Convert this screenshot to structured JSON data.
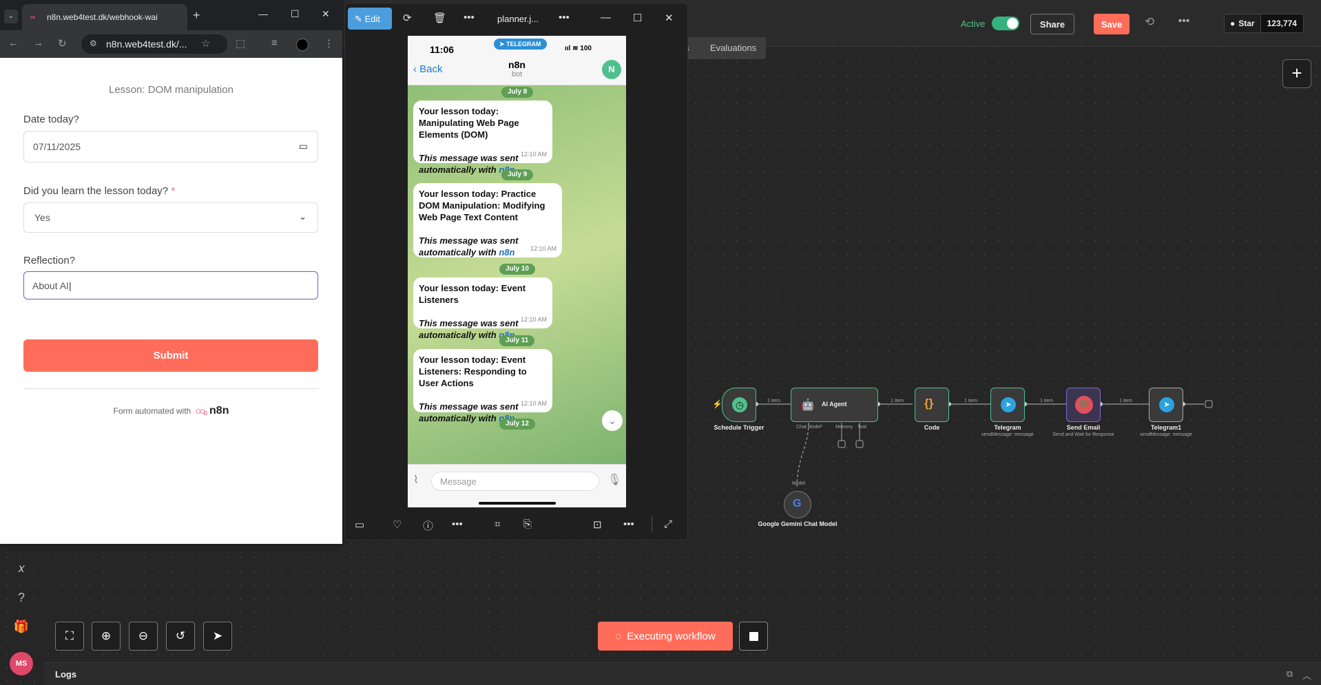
{
  "n8n": {
    "active_label": "Active",
    "share_label": "Share",
    "save_label": "Save",
    "star_label": "Star",
    "star_count": "123,774",
    "tab_partial": "s",
    "tab_evaluations": "Evaluations",
    "executing_label": "Executing workflow",
    "logs_label": "Logs",
    "avatar_initials": "MS",
    "accent_color": "#ff6d5a",
    "active_color": "#35b37e"
  },
  "workflow": {
    "nodes": [
      {
        "name": "Schedule Trigger",
        "icon": "clock-icon"
      },
      {
        "name": "AI Agent",
        "icon": "robot-icon",
        "ports": [
          "Chat Model*",
          "Memory",
          "Tool"
        ]
      },
      {
        "name": "Code",
        "icon": "braces-icon"
      },
      {
        "name": "Telegram",
        "sub": "sendMessage: message",
        "icon": "telegram-icon"
      },
      {
        "name": "Send Email",
        "sub": "Send and Wait for Response",
        "icon": "email-icon"
      },
      {
        "name": "Telegram1",
        "sub": "sendMessage: message",
        "icon": "telegram-icon"
      },
      {
        "name": "Google Gemini Chat Model",
        "icon": "google-icon",
        "port": "Model"
      }
    ],
    "connection_label": "1 item"
  },
  "browser": {
    "tab_title": "n8n.web4test.dk/webhook-wai",
    "url": "n8n.web4test.dk/..."
  },
  "form": {
    "lesson": "Lesson: DOM manipulation",
    "date_label": "Date today?",
    "date_value": "07/11/2025",
    "learned_label": "Did you learn the lesson today?",
    "required_mark": "*",
    "learned_value": "Yes",
    "reflection_label": "Reflection?",
    "reflection_value": "About AI",
    "submit_label": "Submit",
    "powered_text": "Form automated with",
    "powered_brand": "n8n"
  },
  "viewer": {
    "edit_label": "Edit",
    "file_title": "planner.j..."
  },
  "phone": {
    "time": "11:06",
    "telegram_label": "TELEGRAM",
    "battery": "100",
    "back_label": "Back",
    "chat_name": "n8n",
    "chat_sub": "bot",
    "chat_avatar": "N",
    "input_placeholder": "Message",
    "messages": [
      {
        "date": "July 8",
        "title": "Your lesson today: Manipulating Web Page Elements (DOM)",
        "auto": "This message was sent automatically with",
        "link": "n8n",
        "time": "12:10 AM"
      },
      {
        "date": "July 9",
        "title": "Your lesson today: Practice DOM Manipulation: Modifying Web Page Text Content",
        "auto": "This message was sent automatically with",
        "link": "n8n",
        "time": "12:10 AM"
      },
      {
        "date": "July 10",
        "title": "Your lesson today: Event Listeners",
        "auto": "This message was sent automatically with",
        "link": "n8n",
        "time": "12:10 AM"
      },
      {
        "date": "July 11",
        "title": "Your lesson today: Event Listeners: Responding to User Actions",
        "auto": "This message was sent automatically with",
        "link": "n8n",
        "time": "12:10 AM"
      }
    ],
    "last_date": "July 12"
  }
}
